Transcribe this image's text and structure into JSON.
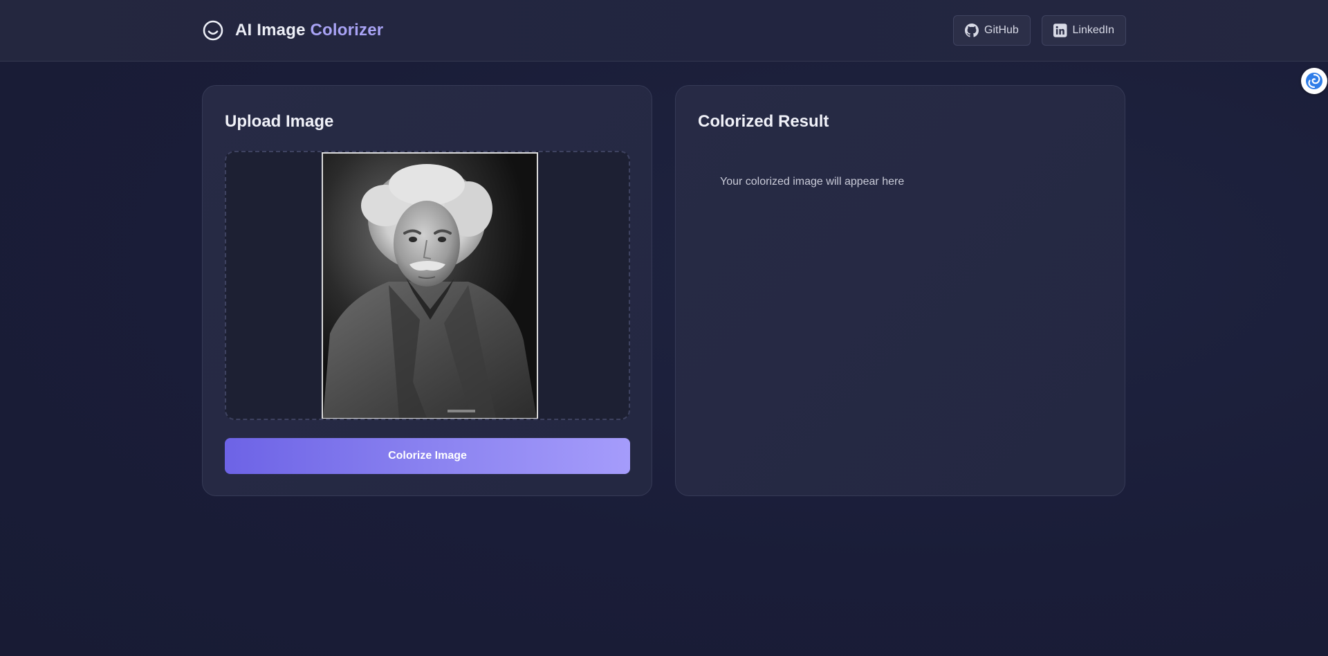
{
  "header": {
    "title_main": "AI Image",
    "title_accent": "Colorizer",
    "links": {
      "github_label": "GitHub",
      "linkedin_label": "LinkedIn"
    }
  },
  "upload_panel": {
    "title": "Upload Image",
    "image_alt": "Uploaded black and white portrait photo",
    "button_label": "Colorize Image"
  },
  "result_panel": {
    "title": "Colorized Result",
    "placeholder": "Your colorized image will appear here"
  },
  "colors": {
    "accent": "#a9a3f5",
    "button_start": "#6d63e6",
    "button_end": "#a59cfb",
    "background": "#1a1d38"
  },
  "icons": {
    "brand": "smile-icon",
    "github": "github-icon",
    "linkedin": "linkedin-icon",
    "extension": "swirl-icon"
  }
}
